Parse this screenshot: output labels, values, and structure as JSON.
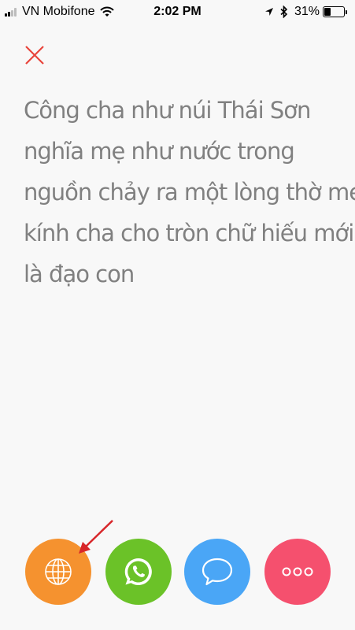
{
  "status_bar": {
    "carrier": "VN Mobifone",
    "time": "2:02 PM",
    "battery_percent": "31%",
    "battery_level": 0.31,
    "signal_bars": 2,
    "icons": [
      "signal-icon",
      "wifi-icon",
      "location-icon",
      "bluetooth-icon",
      "battery-icon"
    ]
  },
  "close_button": {
    "icon": "close-icon",
    "color": "#e8453c"
  },
  "poem": {
    "lines": [
      "Công cha như núi Thái Sơn",
      "nghĩa mẹ như nước trong",
      "nguồn chảy ra một lòng thờ mẹ",
      "kính cha cho tròn chữ hiếu mới",
      "là đạo con"
    ],
    "color": "#808080"
  },
  "actions": [
    {
      "name": "browser",
      "icon": "globe-icon",
      "color": "#f5922f"
    },
    {
      "name": "whatsapp",
      "icon": "whatsapp-icon",
      "color": "#6bc228"
    },
    {
      "name": "message",
      "icon": "chat-bubble-icon",
      "color": "#4aa6f6"
    },
    {
      "name": "more",
      "icon": "more-icon",
      "color": "#f5506e"
    }
  ],
  "annotation": {
    "icon": "red-arrow-icon",
    "color": "#d8262a"
  }
}
